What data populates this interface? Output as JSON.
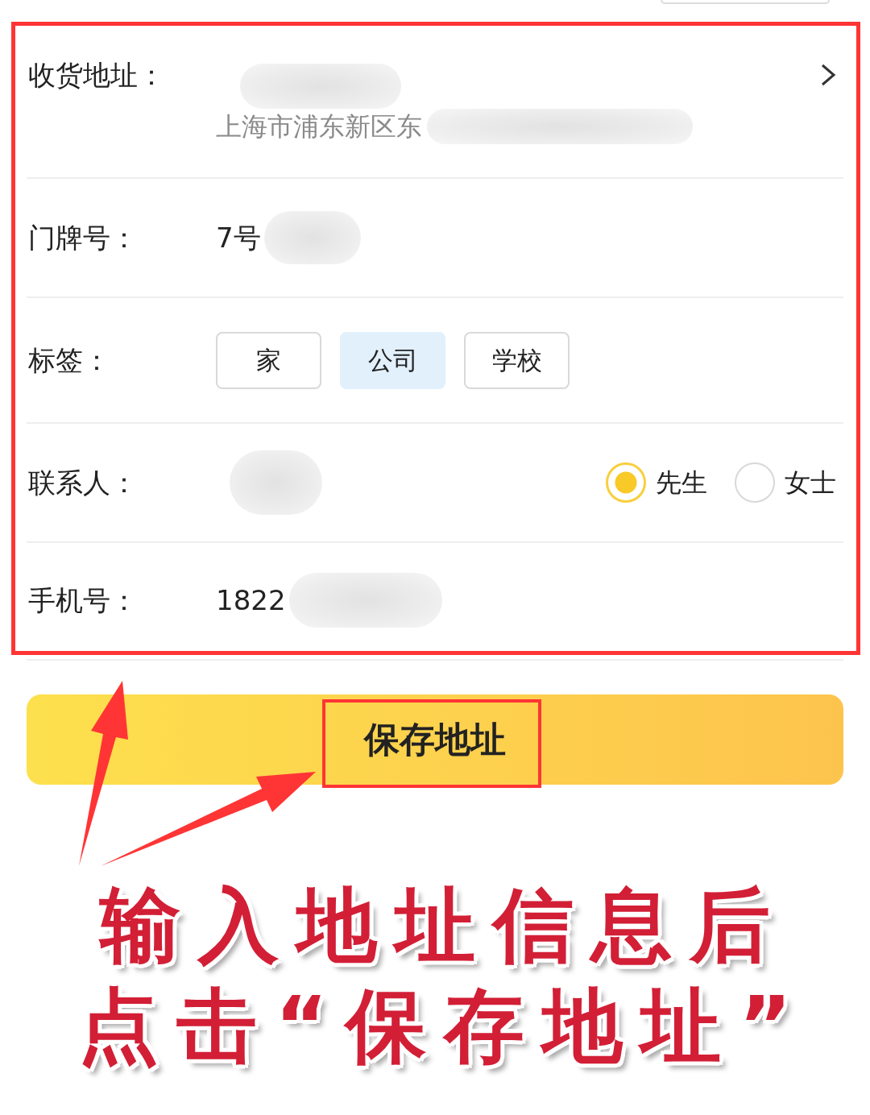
{
  "form": {
    "highlighted": true,
    "rows": [
      {
        "kind": "address",
        "label": "收货地址：",
        "detail": "上海市浦东新区东",
        "redacted": true
      },
      {
        "kind": "text",
        "label": "门牌号：",
        "value": "7号",
        "redacted": true
      },
      {
        "kind": "tags",
        "label": "标签：",
        "options": [
          {
            "label": "家",
            "selected": false
          },
          {
            "label": "公司",
            "selected": true
          },
          {
            "label": "学校",
            "selected": false
          }
        ]
      },
      {
        "kind": "contact",
        "label": "联系人：",
        "redacted": true,
        "options": [
          {
            "label": "先生",
            "selected": true
          },
          {
            "label": "女士",
            "selected": false
          }
        ]
      },
      {
        "kind": "text",
        "label": "手机号：",
        "value": "1822",
        "redacted": true
      }
    ]
  },
  "save_button": {
    "label": "保存地址",
    "highlighted": true
  },
  "annotation": {
    "caption": [
      "输入地址信息后",
      "点击“保存地址”"
    ]
  }
}
